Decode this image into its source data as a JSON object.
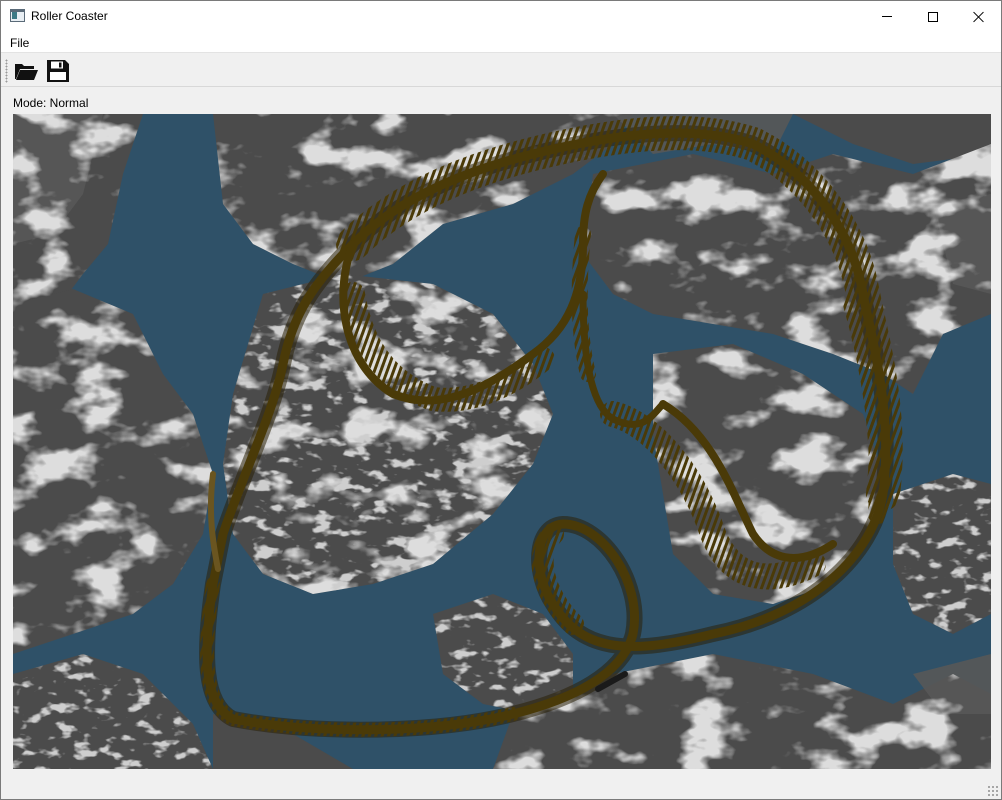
{
  "window": {
    "title": "Roller Coaster",
    "controls": [
      "minimize-icon",
      "maximize-icon",
      "close-icon"
    ]
  },
  "menu": {
    "items": [
      {
        "label": "File"
      }
    ]
  },
  "toolbar": {
    "buttons": [
      {
        "icon": "folder-open-icon"
      },
      {
        "icon": "save-icon"
      }
    ]
  },
  "status": {
    "mode_label": "Mode: Normal"
  },
  "scene": {
    "description_icon": "terrain-viewport",
    "colors": {
      "water": "#2f5168",
      "rock": "#4a4a4a",
      "snow": "#b8b8b8",
      "track": "#4a3a08"
    }
  }
}
